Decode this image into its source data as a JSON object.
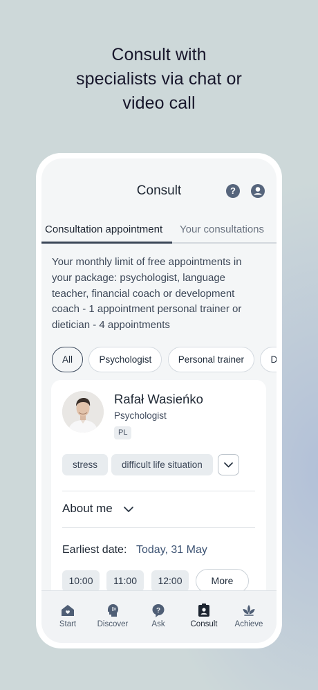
{
  "headline": {
    "line1": "Consult with",
    "line2": "specialists via chat or",
    "line3": "video call"
  },
  "topbar": {
    "title": "Consult",
    "help_icon": "question-circle-icon",
    "profile_icon": "user-circle-icon"
  },
  "tabs": [
    {
      "label": "Consultation appointment",
      "active": true
    },
    {
      "label": "Your consultations",
      "active": false
    }
  ],
  "info_text": "Your monthly limit of free appointments in your package: psychologist, language teacher, financial coach or development coach - 1 appointment personal trainer or dietician - 4 appointments",
  "filters": [
    {
      "label": "All",
      "selected": true
    },
    {
      "label": "Psychologist",
      "selected": false
    },
    {
      "label": "Personal trainer",
      "selected": false
    },
    {
      "label": "Dietician",
      "selected": false
    }
  ],
  "specialist": {
    "name": "Rafał Wasieńko",
    "role": "Psychologist",
    "language": "PL",
    "tags": [
      "stress",
      "difficult life situation"
    ],
    "about_label": "About me",
    "earliest_label": "Earliest date:",
    "earliest_value": "Today, 31 May",
    "slots": [
      "10:00",
      "11:00",
      "12:00"
    ],
    "more_label": "More"
  },
  "bottom_nav": [
    {
      "label": "Start",
      "icon": "home-heart-icon",
      "active": false
    },
    {
      "label": "Discover",
      "icon": "head-idea-icon",
      "active": false
    },
    {
      "label": "Ask",
      "icon": "question-bubble-icon",
      "active": false
    },
    {
      "label": "Consult",
      "icon": "consult-badge-icon",
      "active": true
    },
    {
      "label": "Achieve",
      "icon": "lotus-icon",
      "active": false
    }
  ],
  "colors": {
    "background": "#cdd8d9",
    "accent": "#3a4657",
    "date_value": "#3c5272"
  }
}
